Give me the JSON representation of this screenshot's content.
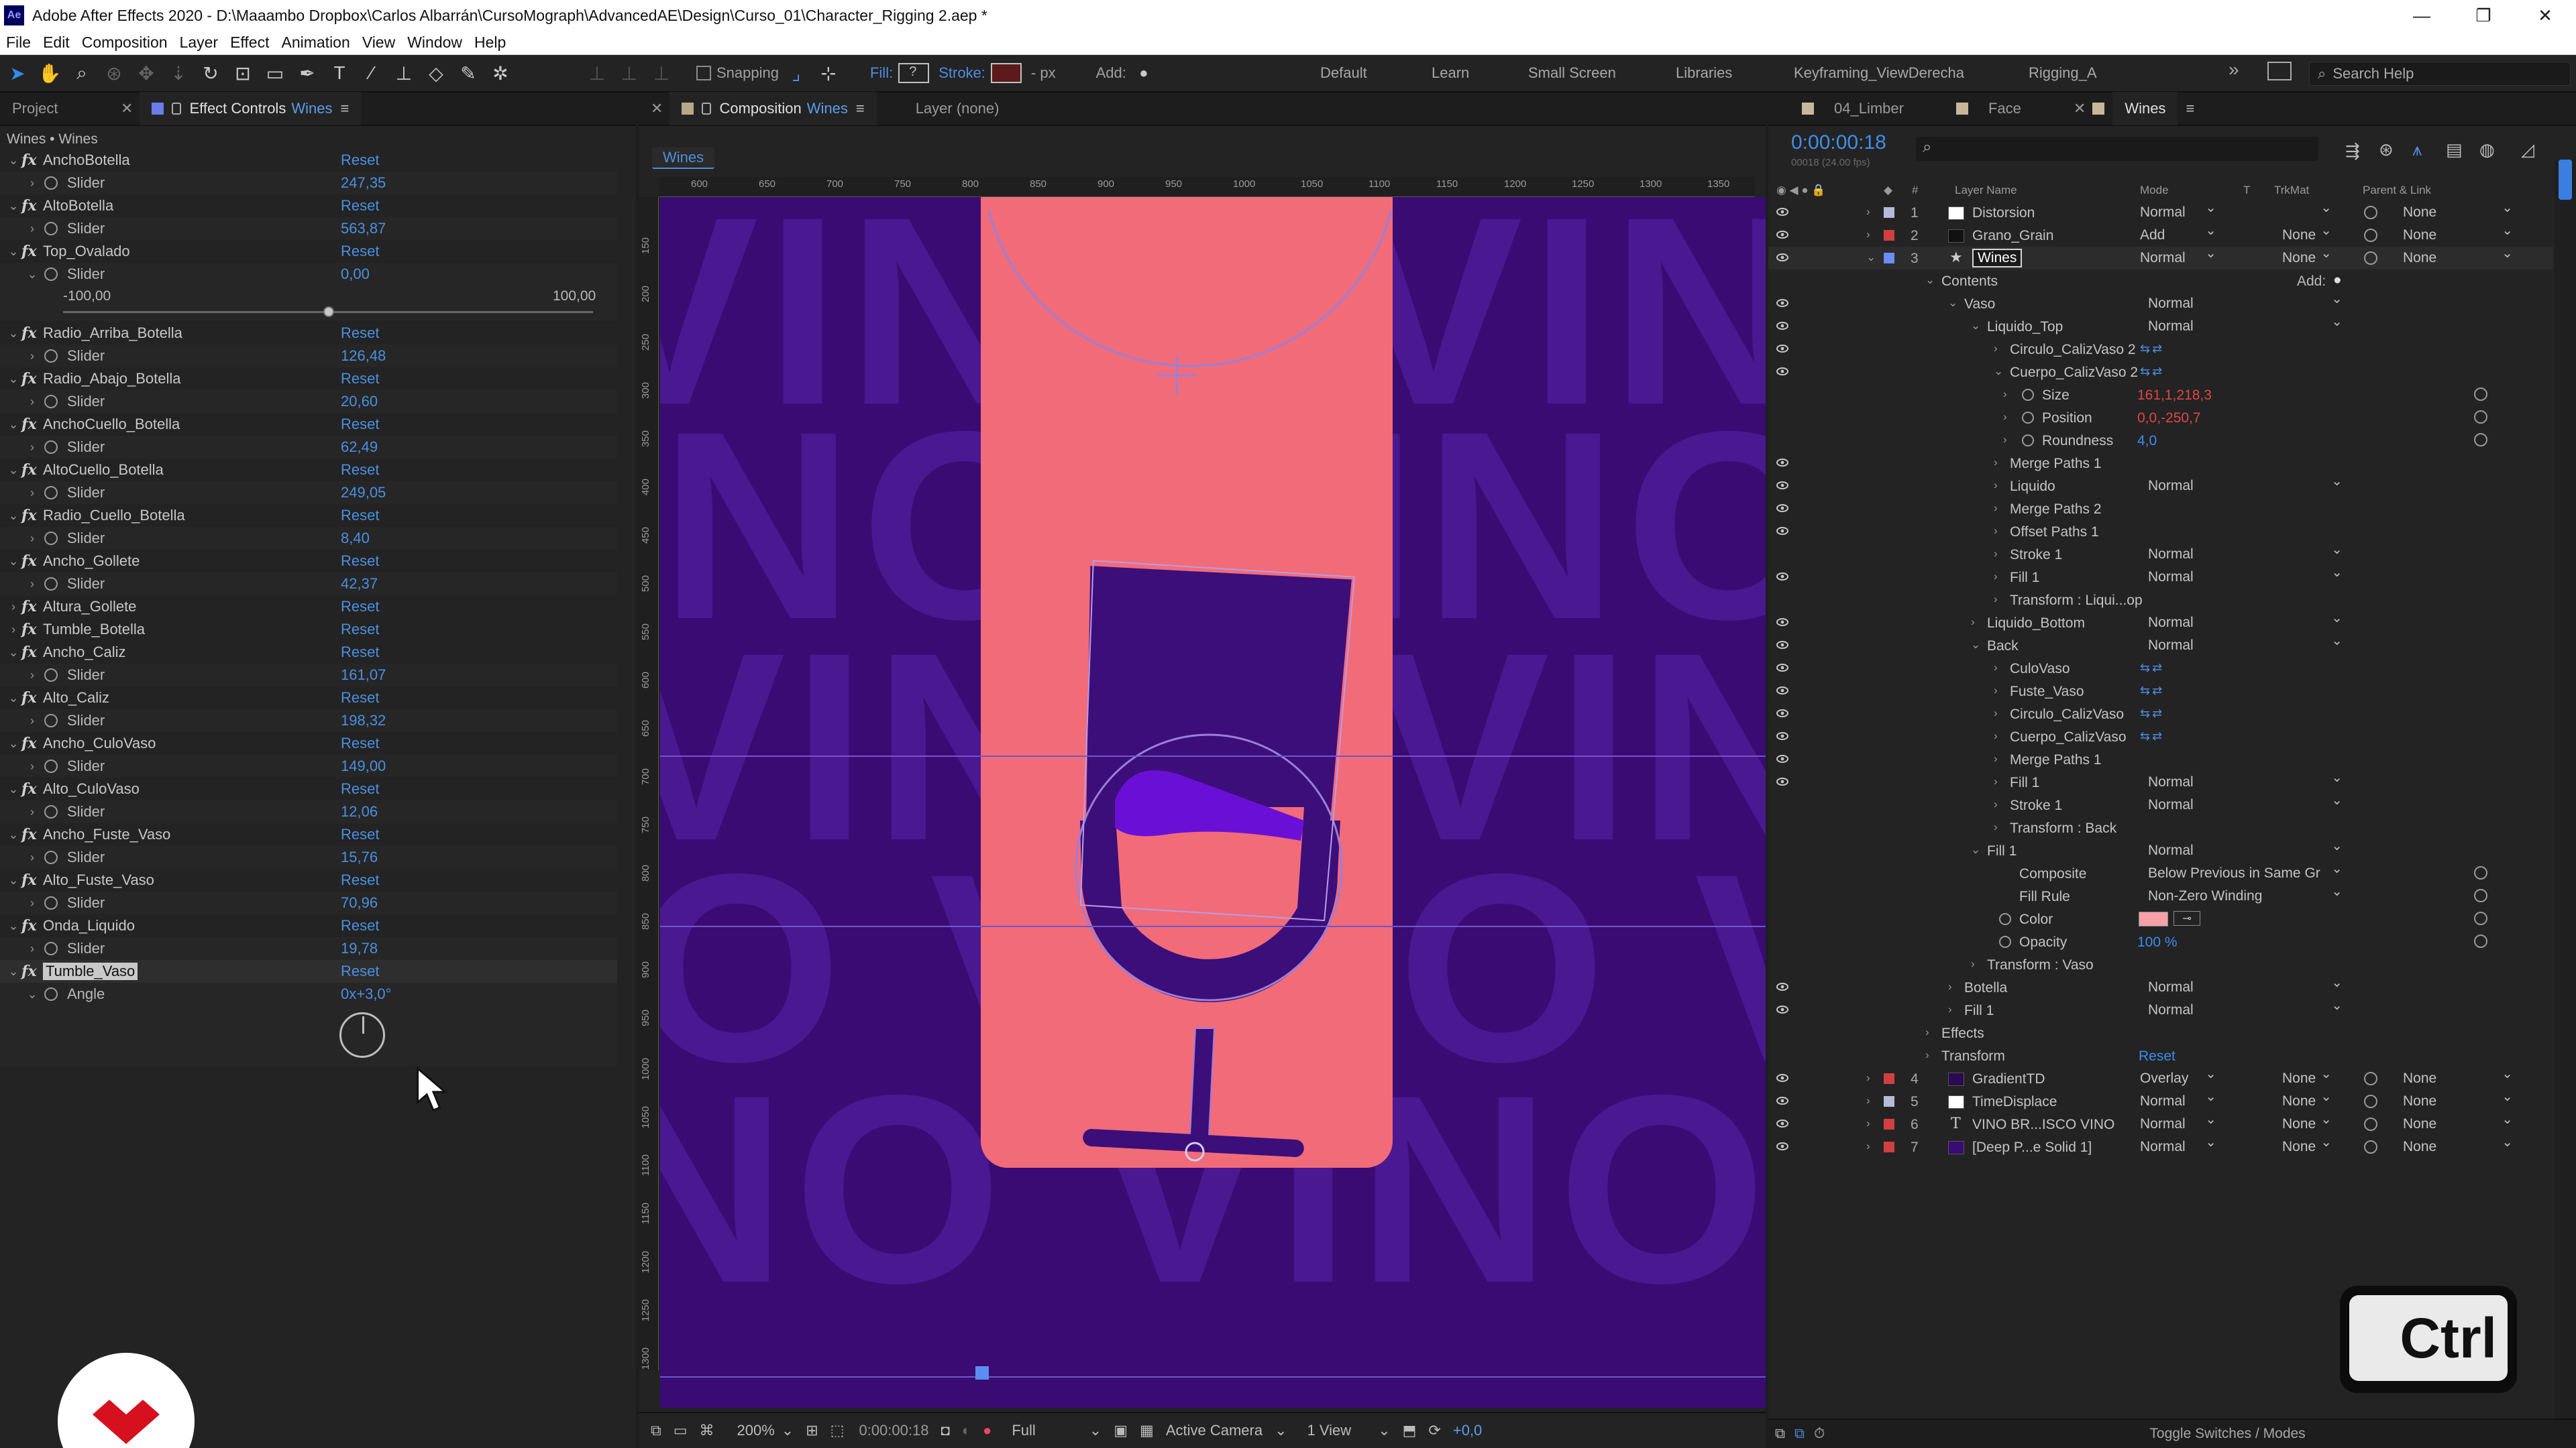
{
  "app": {
    "title": "Adobe After Effects 2020 - D:\\Maaambo Dropbox\\Carlos Albarrán\\CursoMograph\\AdvancedAE\\Design\\Curso_01\\Character_Rigging 2.aep *",
    "icon_text": "Ae"
  },
  "window_controls": [
    "—",
    "❐",
    "✕"
  ],
  "menu": [
    "File",
    "Edit",
    "Composition",
    "Layer",
    "Effect",
    "Animation",
    "View",
    "Window",
    "Help"
  ],
  "toolbar": {
    "snapping": "Snapping",
    "fill": "Fill:",
    "stroke": "Stroke:",
    "px": "- px",
    "add": "Add:",
    "workspaces": [
      "Default",
      "Learn",
      "Small Screen",
      "Libraries",
      "Keyframing_ViewDerecha",
      "Rigging_A"
    ],
    "search_help": "Search Help",
    "more": "»"
  },
  "left_panel": {
    "tabs": [
      {
        "label": "Project"
      },
      {
        "label": "Effect Controls",
        "link": "Wines"
      }
    ],
    "header": "Wines • Wines",
    "reset": "Reset",
    "slider_label": "Slider",
    "angle_label": "Angle",
    "slider_min": "-100,00",
    "slider_max": "100,00",
    "effects": [
      {
        "name": "AnchoBotella",
        "value": "247,35"
      },
      {
        "name": "AltoBotella",
        "value": "563,87"
      },
      {
        "name": "Top_Ovalado",
        "value": "0,00"
      },
      {
        "name": "Radio_Arriba_Botella",
        "value": "126,48"
      },
      {
        "name": "Radio_Abajo_Botella",
        "value": "20,60"
      },
      {
        "name": "AnchoCuello_Botella",
        "value": "62,49"
      },
      {
        "name": "AltoCuello_Botella",
        "value": "249,05"
      },
      {
        "name": "Radio_Cuello_Botella",
        "value": "8,40"
      },
      {
        "name": "Ancho_Gollete",
        "value": "42,37"
      },
      {
        "name": "Altura_Gollete"
      },
      {
        "name": "Tumble_Botella"
      },
      {
        "name": "Ancho_Caliz",
        "value": "161,07"
      },
      {
        "name": "Alto_Caliz",
        "value": "198,32"
      },
      {
        "name": "Ancho_CuloVaso",
        "value": "149,00"
      },
      {
        "name": "Alto_CuloVaso",
        "value": "12,06"
      },
      {
        "name": "Ancho_Fuste_Vaso",
        "value": "15,76"
      },
      {
        "name": "Alto_Fuste_Vaso",
        "value": "70,96"
      },
      {
        "name": "Onda_Liquido",
        "value": "19,78"
      },
      {
        "name": "Tumble_Vaso",
        "angle": "0x+3,0°"
      }
    ]
  },
  "composition": {
    "tab_label": "Composition",
    "tab_link": "Wines",
    "layer_tab": "Layer  (none)",
    "subtab": "Wines",
    "ruler_ticks": [
      "600",
      "650",
      "700",
      "750",
      "800",
      "850",
      "900",
      "950",
      "1000",
      "1050",
      "1100",
      "1150",
      "1200",
      "1250",
      "1300",
      "1350"
    ],
    "ruler_v_ticks": [
      "150",
      "200",
      "250",
      "300",
      "350",
      "400",
      "450",
      "500",
      "550",
      "600",
      "650",
      "700",
      "750",
      "800",
      "850",
      "900",
      "950",
      "1000",
      "1050",
      "1100",
      "1150",
      "1200",
      "1250",
      "1300"
    ],
    "bg_text": [
      "VINO VINO",
      "NO VINO V",
      "VINO VINO",
      "O VINO VIN",
      "NO VINO VINO"
    ],
    "colors": {
      "bg": "#3a0b73",
      "bg_text": "#4a1890",
      "card": "#f26b78",
      "glass": "#3c0e7a",
      "liquid_top": "#6a10d6",
      "guide": "#6f57c9"
    },
    "footer": {
      "zoom": "200%",
      "timecode": "0:00:00:18",
      "resolution": "Full",
      "camera": "Active Camera",
      "views": "1 View",
      "exposure": "+0,0"
    }
  },
  "timeline": {
    "tabs": [
      "04_Limber",
      "Face",
      "Wines"
    ],
    "timecode": "0:00:00:18",
    "fps": "00018 (24.00 fps)",
    "headers": {
      "num": "#",
      "layer_name": "Layer Name",
      "mode": "Mode",
      "t": "T",
      "trkmat": "TrkMat",
      "parent": "Parent & Link"
    },
    "layers": [
      {
        "num": "1",
        "name": "Distorsion",
        "mode": "Normal",
        "trkmat": "",
        "parent": "None",
        "color": "#b8b8d8",
        "src": "#ffffff"
      },
      {
        "num": "2",
        "name": "Grano_Grain",
        "mode": "Add",
        "trkmat": "None",
        "parent": "None",
        "color": "#d04040",
        "src": "#111111"
      },
      {
        "num": "3",
        "name": "Wines",
        "mode": "Normal",
        "trkmat": "None",
        "parent": "None",
        "color": "#6c8cff",
        "src": "star"
      }
    ],
    "tree": [
      {
        "indent": 0,
        "name": "Contents",
        "add": "Add:"
      },
      {
        "indent": 1,
        "name": "Vaso",
        "mode": "Normal",
        "eye": true
      },
      {
        "indent": 2,
        "name": "Liquido_Top",
        "mode": "Normal",
        "eye": true
      },
      {
        "indent": 3,
        "name": "Circulo_CalizVaso 2",
        "switch": true,
        "eye": true
      },
      {
        "indent": 3,
        "name": "Cuerpo_CalizVaso 2",
        "switch": true,
        "eye": true
      },
      {
        "indent": 4,
        "name": "Size",
        "red": "161,1,218,3",
        "prop": true
      },
      {
        "indent": 4,
        "name": "Position",
        "red": "0,0,-250,7",
        "prop": true
      },
      {
        "indent": 4,
        "name": "Roundness",
        "blue": "4,0",
        "prop": true
      },
      {
        "indent": 3,
        "name": "Merge Paths 1",
        "eye": true
      },
      {
        "indent": 3,
        "name": "Liquido",
        "mode": "Normal",
        "eye": true
      },
      {
        "indent": 3,
        "name": "Merge Paths 2",
        "eye": true
      },
      {
        "indent": 3,
        "name": "Offset Paths 1",
        "eye": true
      },
      {
        "indent": 3,
        "name": "Stroke 1",
        "mode": "Normal"
      },
      {
        "indent": 3,
        "name": "Fill 1",
        "mode": "Normal",
        "eye": true
      },
      {
        "indent": 3,
        "name": "Transform : Liqui...op"
      },
      {
        "indent": 2,
        "name": "Liquido_Bottom",
        "mode": "Normal",
        "eye": true
      },
      {
        "indent": 2,
        "name": "Back",
        "mode": "Normal",
        "eye": true
      },
      {
        "indent": 3,
        "name": "CuloVaso",
        "switch": true,
        "eye": true
      },
      {
        "indent": 3,
        "name": "Fuste_Vaso",
        "switch": true,
        "eye": true
      },
      {
        "indent": 3,
        "name": "Circulo_CalizVaso",
        "switch": true,
        "eye": true
      },
      {
        "indent": 3,
        "name": "Cuerpo_CalizVaso",
        "switch": true,
        "eye": true
      },
      {
        "indent": 3,
        "name": "Merge Paths 1",
        "eye": true
      },
      {
        "indent": 3,
        "name": "Fill 1",
        "mode": "Normal",
        "eye": true
      },
      {
        "indent": 3,
        "name": "Stroke 1",
        "mode": "Normal"
      },
      {
        "indent": 3,
        "name": "Transform : Back"
      },
      {
        "indent": 2,
        "name": "Fill 1",
        "mode": "Normal"
      },
      {
        "indent": 3,
        "name": "Composite",
        "mode": "Below Previous in Same Gr",
        "prop2": true
      },
      {
        "indent": 3,
        "name": "Fill Rule",
        "mode": "Non-Zero Winding",
        "prop2": true
      },
      {
        "indent": 3,
        "name": "Color",
        "color_swatch": "#f6a0a8",
        "prop": true
      },
      {
        "indent": 3,
        "name": "Opacity",
        "blue": "100 %",
        "prop": true
      },
      {
        "indent": 2,
        "name": "Transform : Vaso"
      },
      {
        "indent": 1,
        "name": "Botella",
        "mode": "Normal",
        "eye": true
      },
      {
        "indent": 1,
        "name": "Fill 1",
        "mode": "Normal",
        "eye": true
      },
      {
        "indent": 0,
        "name": "Effects"
      },
      {
        "indent": 0,
        "name": "Transform",
        "reset": "Reset"
      }
    ],
    "layers_bottom": [
      {
        "num": "4",
        "name": "GradientTD",
        "mode": "Overlay",
        "trkmat": "None",
        "parent": "None",
        "color": "#d04040",
        "src": "#2a0a50"
      },
      {
        "num": "5",
        "name": "TimeDisplace",
        "mode": "Normal",
        "trkmat": "None",
        "parent": "None",
        "color": "#b8b8d8",
        "src": "#ffffff"
      },
      {
        "num": "6",
        "name": "VINO BR...ISCO VINO",
        "mode": "Normal",
        "trkmat": "None",
        "parent": "None",
        "color": "#d04040",
        "src": "T"
      },
      {
        "num": "7",
        "name": "[Deep P...e Solid 1]",
        "mode": "Normal",
        "trkmat": "None",
        "parent": "None",
        "color": "#d04040",
        "src": "#3a0b73"
      }
    ],
    "footer": "Toggle Switches / Modes"
  },
  "overlay": {
    "key_label": "Ctrl"
  }
}
